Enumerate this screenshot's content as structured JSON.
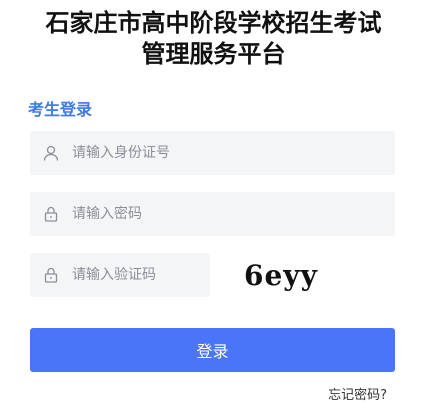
{
  "header": {
    "title_line1": "石家庄市高中阶段学校招生考试",
    "title_line2": "管理服务平台"
  },
  "login": {
    "subtitle": "考生登录",
    "id_placeholder": "请输入身份证号",
    "password_placeholder": "请输入密码",
    "captcha_placeholder": "请输入验证码",
    "captcha_text": "6eyy",
    "submit_label": "登录",
    "forgot_label": "忘记密码?"
  },
  "colors": {
    "accent": "#3d7be8",
    "button": "#4a75f8",
    "field_bg": "#f4f5f7"
  },
  "icons": {
    "id_field": "user-icon",
    "password_field": "lock-icon",
    "captcha_field": "lock-icon"
  }
}
